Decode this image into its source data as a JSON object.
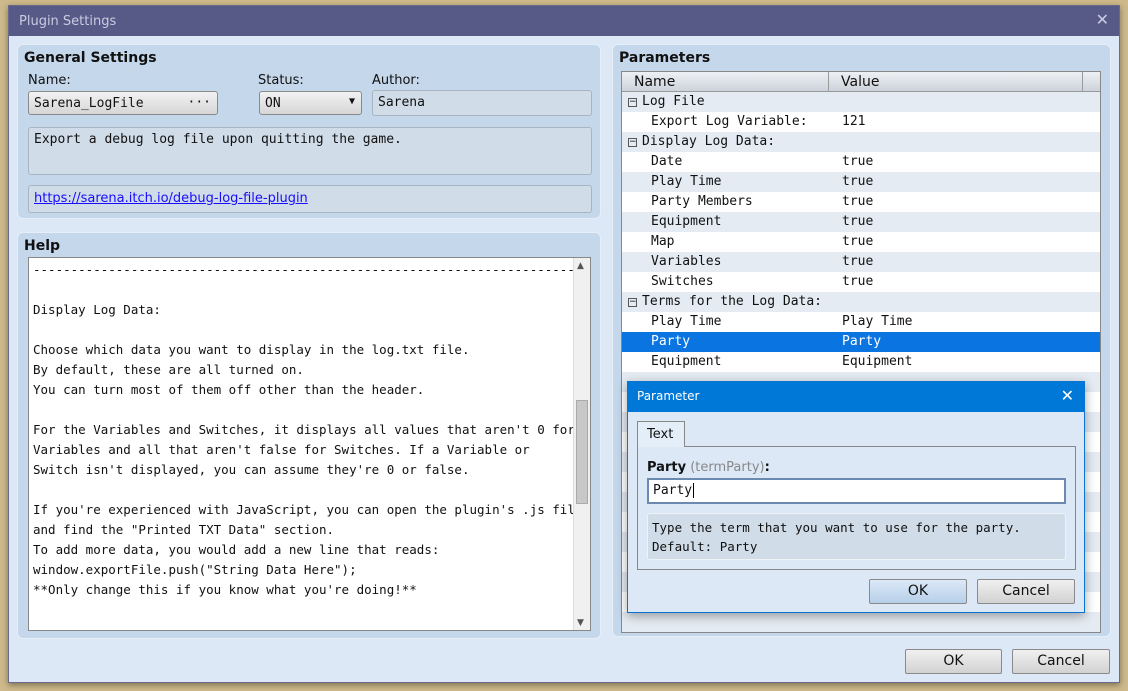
{
  "window": {
    "title": "Plugin Settings",
    "close_icon": "close-icon"
  },
  "general": {
    "heading": "General Settings",
    "name_label": "Name:",
    "name_value": "Sarena_LogFile",
    "name_more": "···",
    "status_label": "Status:",
    "status_value": "ON",
    "author_label": "Author:",
    "author_value": "Sarena",
    "description": "Export a debug log file upon quitting the game.",
    "url": "https://sarena.itch.io/debug-log-file-plugin"
  },
  "help": {
    "heading": "Help",
    "text": "--------------------------------------------------------------------------\n\nDisplay Log Data:\n\nChoose which data you want to display in the log.txt file.\nBy default, these are all turned on.\nYou can turn most of them off other than the header.\n\nFor the Variables and Switches, it displays all values that aren't 0 for\nVariables and all that aren't false for Switches. If a Variable or\nSwitch isn't displayed, you can assume they're 0 or false.\n\nIf you're experienced with JavaScript, you can open the plugin's .js file\nand find the \"Printed TXT Data\" section.\nTo add more data, you would add a new line that reads:\nwindow.exportFile.push(\"String Data Here\");\n**Only change this if you know what you're doing!**"
  },
  "parameters": {
    "heading": "Parameters",
    "col_name": "Name",
    "col_value": "Value",
    "rows": [
      {
        "name": "Log File",
        "value": "",
        "group": true
      },
      {
        "name": "Export Log Variable:",
        "value": "121"
      },
      {
        "name": "Display Log Data:",
        "value": "",
        "group": true
      },
      {
        "name": "Date",
        "value": "true"
      },
      {
        "name": "Play Time",
        "value": "true"
      },
      {
        "name": "Party Members",
        "value": "true"
      },
      {
        "name": "Equipment",
        "value": "true"
      },
      {
        "name": "Map",
        "value": "true"
      },
      {
        "name": "Variables",
        "value": "true"
      },
      {
        "name": "Switches",
        "value": "true"
      },
      {
        "name": "Terms for the Log Data:",
        "value": "",
        "group": true
      },
      {
        "name": "Play Time",
        "value": "Play Time"
      },
      {
        "name": "Party",
        "value": "Party",
        "selected": true
      },
      {
        "name": "Equipment",
        "value": "Equipment"
      }
    ]
  },
  "dialog": {
    "title": "Parameter",
    "tab": "Text",
    "field_label": "Party",
    "field_key": "(termParty)",
    "field_colon": ":",
    "field_value": "Party",
    "description": "Type the term that you want to use for the party.\nDefault: Party",
    "ok": "OK",
    "cancel": "Cancel"
  },
  "footer": {
    "ok": "OK",
    "cancel": "Cancel"
  },
  "colors": {
    "titlebar": "#575a86",
    "dialog_titlebar": "#0078d7",
    "selection": "#0a74e0",
    "link": "#1a0dff"
  }
}
